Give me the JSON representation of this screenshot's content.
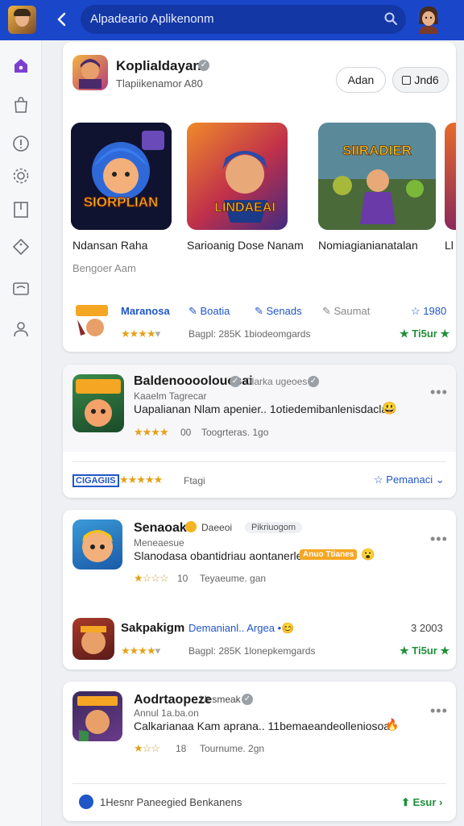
{
  "topbar": {
    "search_text": "Alpadeario Aplikenonm"
  },
  "featured": {
    "title": "Koplialdayan",
    "subtitle": "Tlapiikenamor A80",
    "btn_primary": "Adan",
    "btn_secondary": "Jnd6",
    "games": [
      {
        "label": "Ndansan Raha",
        "art_text": "SIORPLIAN"
      },
      {
        "label": "Sarioanig Dose Nanam",
        "art_text": "LINDAEAI"
      },
      {
        "label": "Nomiagianianatalan",
        "art_text": "SIIRADIER"
      },
      {
        "label": "Ll"
      }
    ],
    "section_label": "Bengoer Aam",
    "actions": {
      "a1": "Maranosa",
      "a2": "Boatia",
      "a3": "Senads",
      "a4": "Saumat",
      "score": "1980"
    },
    "meta": "Bagpl: 285K   1biodeomgards",
    "rating_green": "Ti5ur"
  },
  "card2": {
    "title": "Baldenoooolouesai",
    "chip_text": "Dlarka ugeoes",
    "subtitle": "Kaaelm Tagrecar",
    "description": "Uapalianan Nlam apenier.. 1otiedemibanlenisdaclaa",
    "rating_value": "00",
    "meta": "Toogrteras. 1go",
    "tag": "CIGAGIIS",
    "footer_meta": "Ftagi",
    "footer_action": "Pemanaci"
  },
  "card3": {
    "title": "Senaoak",
    "label": "Daeeoi",
    "chip": "Pikriuogom",
    "subtitle": "Meneaesue",
    "description": "Slanodasa obantidriau aontanerle..",
    "orange_tag": "Anuo Ttianes",
    "rating_value": "10",
    "meta": "Teyaeume. gan",
    "item_title": "Sakpakigm",
    "item_link": "Demanianl.. Argea",
    "item_score": "3 2003",
    "item_meta": "Bagpl: 285K   1lonepkemgards",
    "item_green": "Ti5ur"
  },
  "card4": {
    "title": "Aodrtaopeze",
    "label": "Uesmeak",
    "subtitle": "Annul 1a.ba.on",
    "description": "Calkarianaa Kam aprana.. 11bemaeandeolleniosoa",
    "rating_value": "18",
    "meta": "Tournume. 2gn",
    "footer_text": "1Hesnr Paneegied Benkanens",
    "footer_green": "Esur"
  }
}
